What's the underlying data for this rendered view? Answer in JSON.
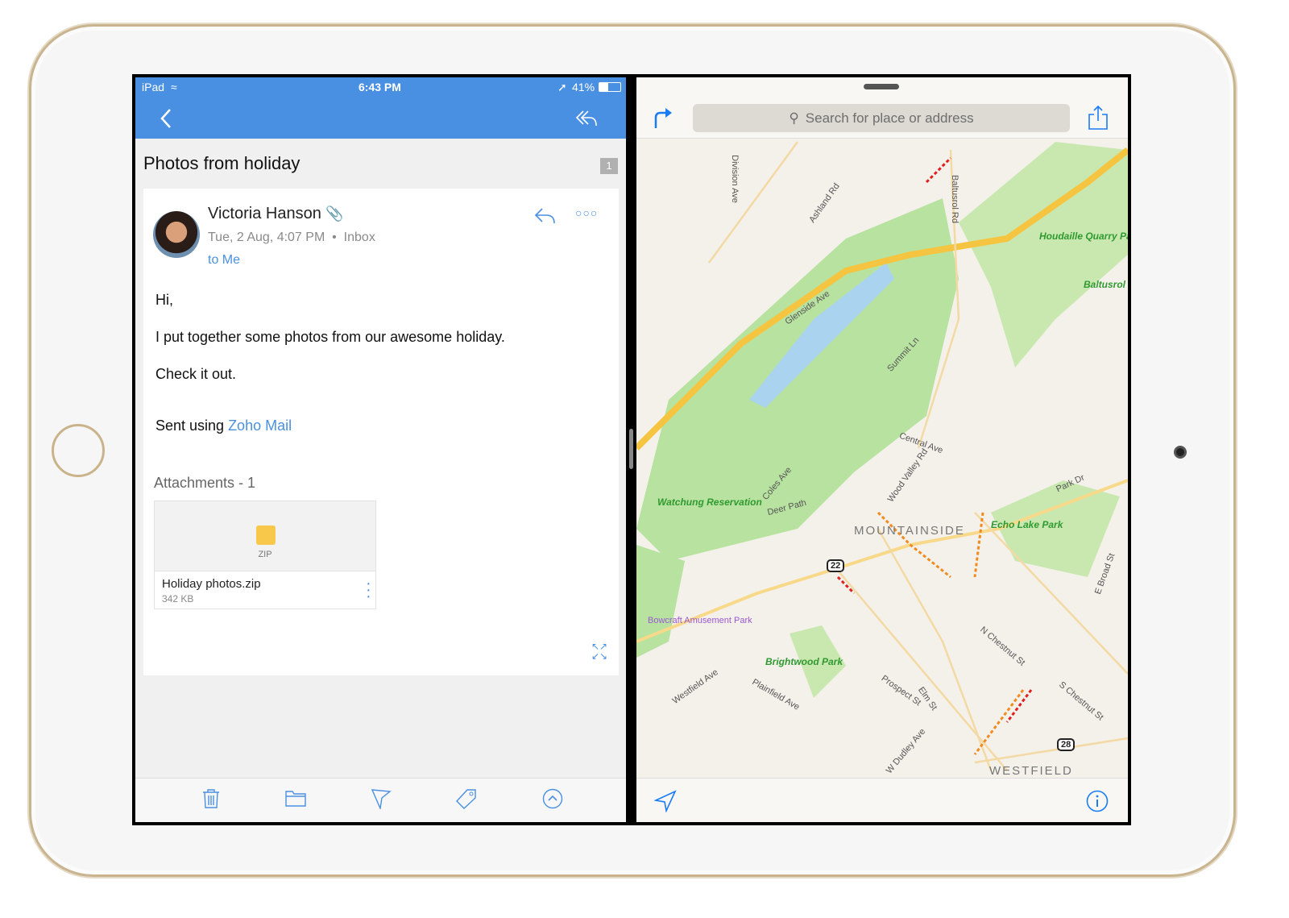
{
  "status": {
    "device": "iPad",
    "time": "6:43 PM",
    "battery": "41%"
  },
  "mail": {
    "subject": "Photos from holiday",
    "thread_count": "1",
    "sender": "Victoria Hanson",
    "date": "Tue, 2 Aug, 4:07 PM",
    "folder": "Inbox",
    "to": "to Me",
    "body": {
      "greeting": "Hi,",
      "line1": "I put together some photos from our awesome holiday.",
      "line2": "Check it out.",
      "signature_prefix": "Sent using ",
      "signature_link": "Zoho Mail"
    },
    "attachments_label": "Attachments - 1",
    "attachment": {
      "type": "ZIP",
      "name": "Holiday photos.zip",
      "size": "342 KB"
    }
  },
  "maps": {
    "search_placeholder": "Search for place or address",
    "labels": {
      "division": "Division Ave",
      "ashland": "Ashland Rd",
      "baltusrol_rd": "Baltusrol Rd",
      "houdaille": "Houdaille Quarry Park",
      "golf": "Baltusrol Golf Club",
      "glenside": "Glenside Ave",
      "summit": "Summit Ln",
      "central": "Central Ave",
      "wood_valley": "Wood Valley Rd",
      "coles": "Coles Ave",
      "deer": "Deer Path",
      "watchung": "Watchung Reservation",
      "mountainside": "MOUNTAINSIDE",
      "echo": "Echo Lake Park",
      "park_dr": "Park Dr",
      "e_broad": "E Broad St",
      "route22": "22",
      "bowcraft": "Bowcraft Amusement Park",
      "brightwood": "Brightwood Park",
      "westfield_ave": "Westfield Ave",
      "plainfield": "Plainfield Ave",
      "prospect": "Prospect St",
      "elm": "Elm St",
      "n_chestnut": "N Chestnut St",
      "s_chestnut": "S Chestnut St",
      "route28": "28",
      "dudley": "W Dudley Ave",
      "westfield": "WESTFIELD"
    }
  },
  "colors": {
    "accent": "#4a90e2",
    "park": "#b8e2a0",
    "road": "#f5c542"
  }
}
